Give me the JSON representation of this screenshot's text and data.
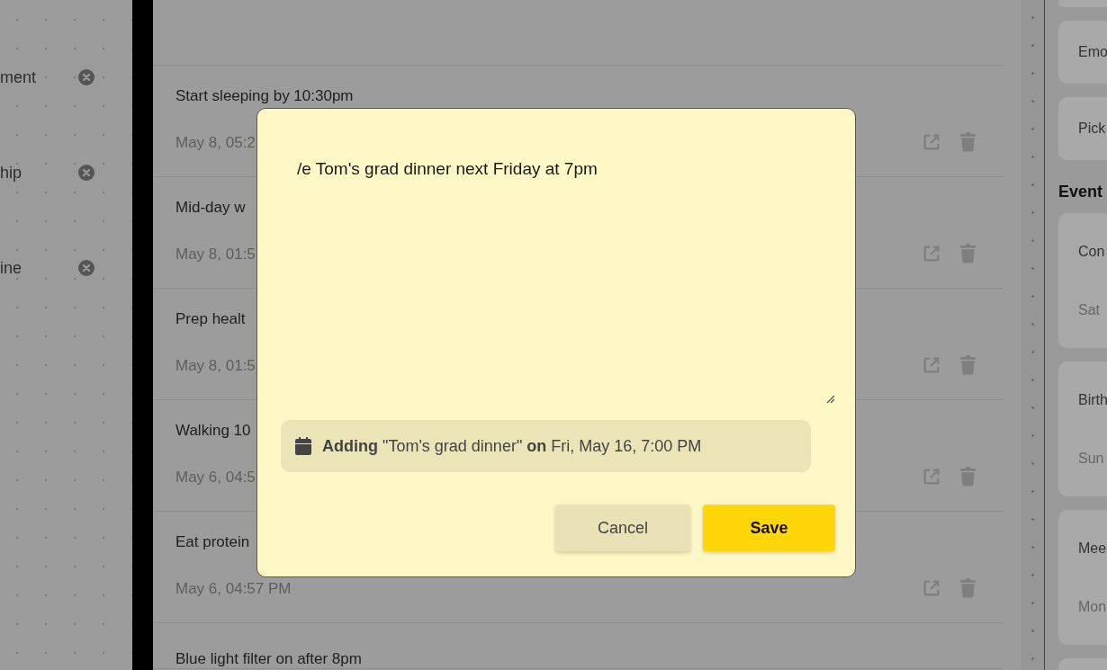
{
  "sidebar": {
    "items": [
      {
        "label": "ment"
      },
      {
        "label": "hip"
      },
      {
        "label": "ine"
      }
    ]
  },
  "list": {
    "items": [
      {
        "title": "Start sleeping by 10:30pm",
        "date": "May 8, 05:2"
      },
      {
        "title": "Mid-day w",
        "date": "May 8, 01:5"
      },
      {
        "title": "Prep healt",
        "date": "May 8, 01:5"
      },
      {
        "title": "Walking 10",
        "date": "May 6, 04:5"
      },
      {
        "title": "Eat protein",
        "date": "May 6, 04:57 PM"
      },
      {
        "title": "Blue light filter on after 8pm"
      }
    ]
  },
  "right_panel": {
    "cards": [
      {
        "title": "Emo"
      },
      {
        "title": "Pick"
      }
    ],
    "events_heading": "Event",
    "events": [
      {
        "title": "Con",
        "date": "Sat"
      },
      {
        "title": "Birth",
        "date": "Sun"
      },
      {
        "title": "Mee",
        "date": "Mon"
      }
    ]
  },
  "modal": {
    "input_value": "/e Tom's grad dinner next Friday at 7pm",
    "preview": "**Adding** \"Tom's grad dinner\" **on** Fri, May 16, 7:00 PM",
    "buttons": [
      {
        "label": "Cancel",
        "kind": "secondary"
      },
      {
        "label": "Save",
        "kind": "primary"
      }
    ]
  }
}
